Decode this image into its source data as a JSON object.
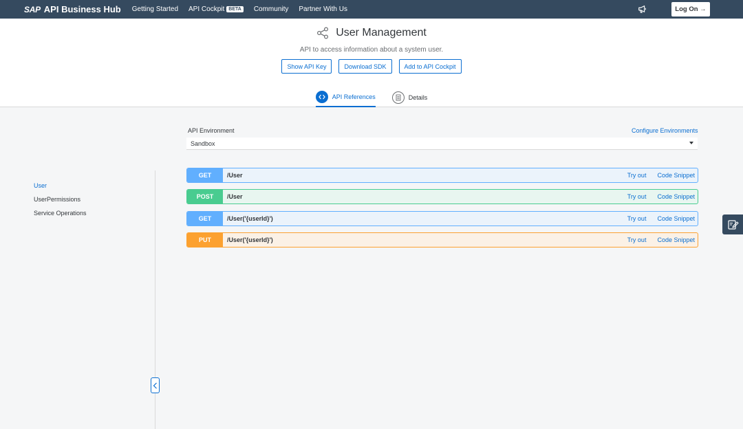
{
  "topbar": {
    "brand_sap": "SAP",
    "brand_name": "API Business Hub",
    "nav": [
      "Getting Started",
      "API Cockpit",
      "Community",
      "Partner With Us"
    ],
    "beta_badge": "BETA",
    "logon_label": "Log On →",
    "notification_icon": "megaphone-icon"
  },
  "header": {
    "title": "User Management",
    "subtitle": "API to access information about a system user.",
    "buttons": [
      "Show API Key",
      "Download SDK",
      "Add to API Cockpit"
    ],
    "tabs": [
      "API References",
      "Details"
    ]
  },
  "sidebar": {
    "items": [
      "User",
      "UserPermissions",
      "Service Operations"
    ]
  },
  "main": {
    "env_label": "API Environment",
    "config_link": "Configure Environments",
    "env_value": "Sandbox",
    "operations": [
      {
        "method": "GET",
        "path": "/User",
        "try": "Try out",
        "snippet": "Code Snippet"
      },
      {
        "method": "POST",
        "path": "/User",
        "try": "Try out",
        "snippet": "Code Snippet"
      },
      {
        "method": "GET",
        "path": "/User('{userId}')",
        "try": "Try out",
        "snippet": "Code Snippet"
      },
      {
        "method": "PUT",
        "path": "/User('{userId}')",
        "try": "Try out",
        "snippet": "Code Snippet"
      }
    ]
  },
  "colors": {
    "shell": "#354a5f",
    "accent": "#0a6ed1",
    "get": "#61affe",
    "post": "#49cc90",
    "put": "#fca130"
  }
}
